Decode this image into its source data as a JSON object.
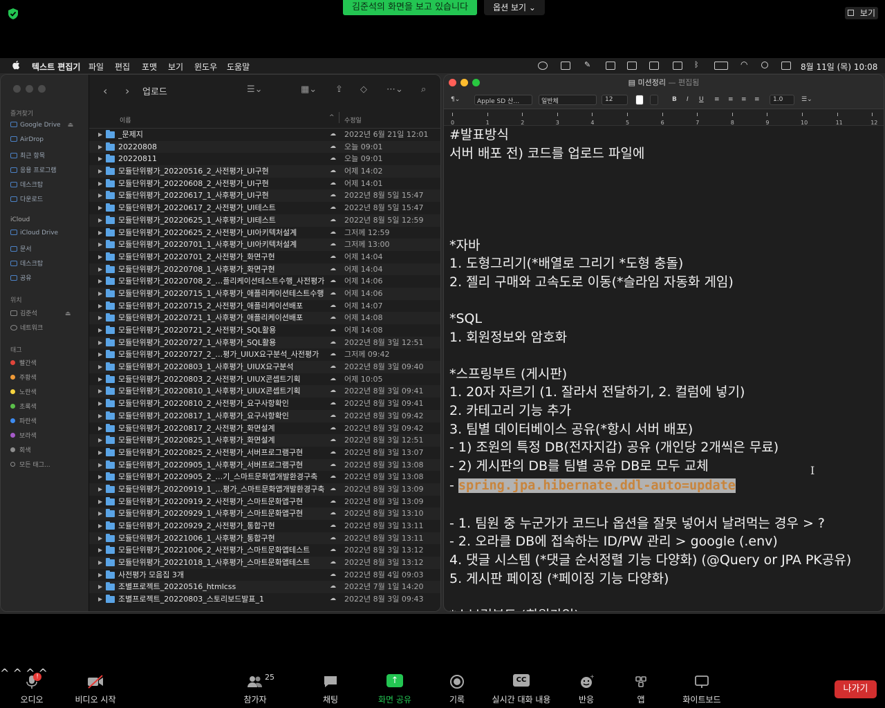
{
  "zoom": {
    "banner": "김준석의 화면을 보고 있습니다",
    "options_label": "옵션 보기 ⌄",
    "view_label": "보기",
    "bottom": {
      "audio": "오디오",
      "video": "비디오 시작",
      "participants": "참가자",
      "participants_count": "25",
      "chat": "채팅",
      "share": "화면 공유",
      "record": "기록",
      "captions": "실시간 대화 내용",
      "captions_icon": "CC",
      "reactions": "반응",
      "apps": "앱",
      "whiteboard": "화이트보드",
      "leave": "나가기",
      "audio_badge": "!"
    },
    "colors": {
      "share_green": "#23c552",
      "leave_red": "#d32f2f"
    }
  },
  "menubar": {
    "app": "텍스트 편집기",
    "items": [
      "파일",
      "편집",
      "포맷",
      "보기",
      "윈도우",
      "도움말"
    ],
    "clock": "8월 11일 (목)  10:08"
  },
  "finder": {
    "title": "업로드",
    "sidebar": {
      "favorites_header": "즐겨찾기",
      "favorites": [
        "Google Drive",
        "AirDrop",
        "최근 항목",
        "응용 프로그램",
        "데스크탑",
        "다운로드"
      ],
      "icloud_header": "iCloud",
      "icloud": [
        "iCloud Drive",
        "문서",
        "데스크탑",
        "공유"
      ],
      "locations_header": "위치",
      "locations": [
        "김준석",
        "네트워크"
      ],
      "tags_header": "태그",
      "tags": [
        {
          "label": "빨간색",
          "color": "#e0453a"
        },
        {
          "label": "주황색",
          "color": "#f09a37"
        },
        {
          "label": "노란색",
          "color": "#f5d33f"
        },
        {
          "label": "초록색",
          "color": "#5bc04a"
        },
        {
          "label": "파란색",
          "color": "#3d8bf0"
        },
        {
          "label": "보라색",
          "color": "#a55ac8"
        },
        {
          "label": "회색",
          "color": "#8d8d8d"
        },
        {
          "label": "모든 태그...",
          "color": ""
        }
      ]
    },
    "columns": {
      "name": "이름",
      "date": "수정일"
    },
    "rows": [
      {
        "name": "_문제지",
        "date": "2022년 6월 21일 12:01"
      },
      {
        "name": "20220808",
        "date": "오늘 09:01"
      },
      {
        "name": "20220811",
        "date": "오늘 09:01"
      },
      {
        "name": "모듈단위평가_20220516_2_사전평가_UI구현",
        "date": "어제 14:02"
      },
      {
        "name": "모듈단위평가_20220608_2_사전평가_UI구현",
        "date": "어제 14:01"
      },
      {
        "name": "모듈단위평가_20220617_1_사후평가_UI구현",
        "date": "2022년 8월 5일 15:47"
      },
      {
        "name": "모듈단위평가_20220617_2_사전평가_UI테스트",
        "date": "2022년 8월 5일 15:47"
      },
      {
        "name": "모듈단위평가_20220625_1_사후평가_UI테스트",
        "date": "2022년 8월 5일 12:59"
      },
      {
        "name": "모듈단위평가_20220625_2_사전평가_UI아키텍처설계",
        "date": "그저께 12:59"
      },
      {
        "name": "모듈단위평가_20220701_1_사후평가_UI아키텍처설계",
        "date": "그저께 13:00"
      },
      {
        "name": "모듈단위평가_20220701_2_사전평가_화면구현",
        "date": "어제 14:04"
      },
      {
        "name": "모듈단위평가_20220708_1_사후평가_화면구현",
        "date": "어제 14:04"
      },
      {
        "name": "모듈단위평가_20220708_2_…플리케이션테스트수행_사전평가",
        "date": "어제 14:06"
      },
      {
        "name": "모듈단위평가_20220715_1_사후평가_애플리케이션테스트수행",
        "date": "어제 14:06"
      },
      {
        "name": "모듈단위평가_20220715_2_사전평가_애플리케이션배포",
        "date": "어제 14:07"
      },
      {
        "name": "모듈단위평가_20220721_1_사후평가_애플리케이션배포",
        "date": "어제 14:08"
      },
      {
        "name": "모듈단위평가_20220721_2_사전평가_SQL활용",
        "date": "어제 14:08"
      },
      {
        "name": "모듈단위평가_20220727_1_사후평가_SQL활용",
        "date": "2022년 8월 3일 12:51"
      },
      {
        "name": "모듈단위평가_20220727_2_…평가_UIUX요구분석_사전평가",
        "date": "그저께 09:42"
      },
      {
        "name": "모듈단위평가_20220803_1_사후평가_UIUX요구분석",
        "date": "2022년 8월 3일 09:40"
      },
      {
        "name": "모듈단위평가_20220803_2_사전평가_UIUX콘셉트기획",
        "date": "어제 10:05"
      },
      {
        "name": "모듈단위평가_20220810_1_사후평가_UIUX콘셉트기획",
        "date": "2022년 8월 3일 09:41"
      },
      {
        "name": "모듈단위평가_20220810_2_사전평가_요구사항확인",
        "date": "2022년 8월 3일 09:41"
      },
      {
        "name": "모듈단위평가_20220817_1_사후평가_요구사항확인",
        "date": "2022년 8월 3일 09:42"
      },
      {
        "name": "모듈단위평가_20220817_2_사전평가_화면설계",
        "date": "2022년 8월 3일 09:42"
      },
      {
        "name": "모듈단위평가_20220825_1_사후평가_화면설계",
        "date": "2022년 8월 3일 12:51"
      },
      {
        "name": "모듈단위평가_20220825_2_사전평가_서버프로그램구현",
        "date": "2022년 8월 3일 13:07"
      },
      {
        "name": "모듈단위평가_20220905_1_사후평가_서버프로그램구현",
        "date": "2022년 8월 3일 13:08"
      },
      {
        "name": "모듈단위평가_20220905_2_…기_스마트문화앱개발환경구축",
        "date": "2022년 8월 3일 13:08"
      },
      {
        "name": "모듈단위평가_20220919_1_…평가_스마트문화앱개발환경구축",
        "date": "2022년 8월 3일 13:09"
      },
      {
        "name": "모듈단위평가_20220919_2_사전평가_스마트문화앱구현",
        "date": "2022년 8월 3일 13:09"
      },
      {
        "name": "모듈단위평가_20220929_1_사후평가_스마트문화앱구현",
        "date": "2022년 8월 3일 13:10"
      },
      {
        "name": "모듈단위평가_20220929_2_사전평가_통합구현",
        "date": "2022년 8월 3일 13:11"
      },
      {
        "name": "모듈단위평가_20221006_1_사후평가_통합구현",
        "date": "2022년 8월 3일 13:11"
      },
      {
        "name": "모듈단위평가_20221006_2_사전평가_스마트문화앱테스트",
        "date": "2022년 8월 3일 13:12"
      },
      {
        "name": "모듈단위평가_20221018_1_사후평가_스마트문화앱테스트",
        "date": "2022년 8월 3일 13:12"
      },
      {
        "name": "사전평가 모음집 3개",
        "date": "2022년 8월 4일 09:03"
      },
      {
        "name": "조별프로젝트_20220516_htmlcss",
        "date": "2022년 7월 1일 14:20"
      },
      {
        "name": "조별프로젝트_20220803_스토리보드발표_1",
        "date": "2022년 8월 3일 09:43"
      }
    ]
  },
  "textedit": {
    "title": "미션정리",
    "title_suffix": "— 편집됨",
    "toolbar": {
      "font": "Apple SD 산…",
      "style": "일반체",
      "size": "12",
      "spacing": "1.0",
      "bold": "B",
      "italic": "I",
      "underline": "U"
    },
    "ruler_labels": [
      "0",
      "1",
      "2",
      "3",
      "4",
      "5",
      "6",
      "7",
      "8",
      "9",
      "10",
      "11",
      "12"
    ],
    "lines": [
      "#발표방식",
      "서버 배포 전) 코드를 업로드 파일에",
      "",
      "",
      "",
      "",
      "*자바",
      "1. 도형그리기(*배열로 그리기 *도형 충돌)",
      "2. 젤리 구매와 고속도로 이동(*슬라임 자동화 게임)",
      "",
      "*SQL",
      "1. 회원정보와 암호화",
      "",
      "*스프링부트 (게시판)",
      "1. 20자 자르기 (1. 잘라서 전달하기, 2. 컬럼에 넣기)",
      "2. 카테고리 기능 추가",
      "3. 팀별 데이터베이스 공유(*항시 서버 배포)",
      "- 1) 조원의 특정 DB(전자지갑) 공유 (개인당 2개씩은 무료)",
      "- 2) 게시판의 DB를 팀별 공유 DB로 모두 교체"
    ],
    "code_prefix": "- ",
    "code_line": "spring.jpa.hibernate.ddl-auto=update",
    "lines_after": [
      "",
      "- 1. 팀원 중 누군가가 코드나 옵션을 잘못 넣어서 날려먹는 경우 > ?",
      "- 2. 오라클 DB에 접속하는 ID/PW 관리 > google (.env)",
      "4. 댓글 시스템 (*댓글 순서정렬 기능 다양화) (@Query or JPA PK공유)",
      "5. 게시판 페이징 (*페이징 기능 다양화)",
      "",
      "*스브링부트 (회원가입)"
    ]
  }
}
